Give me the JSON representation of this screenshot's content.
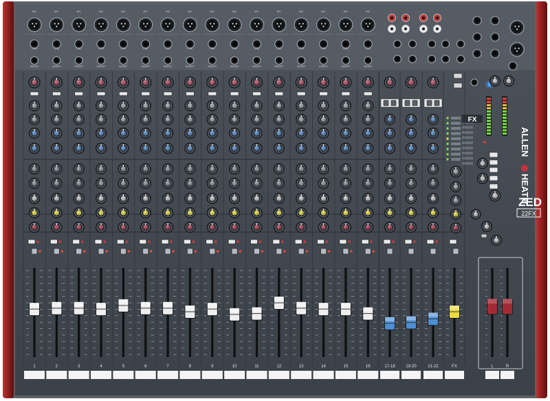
{
  "brand": {
    "name_left": "ALLEN",
    "name_right": "HEATH",
    "model": "ZED",
    "model_sub": "22FX",
    "fx_label": "FX"
  },
  "channels": {
    "mono_numbers": [
      "1",
      "2",
      "3",
      "4",
      "5",
      "6",
      "7",
      "8",
      "9",
      "10",
      "11",
      "12",
      "13",
      "14",
      "15",
      "16"
    ],
    "stereo_numbers": [
      "17-18",
      "19-20",
      "21-22"
    ],
    "fx_strip_number": "FX",
    "master_numbers": [
      "L",
      "R"
    ]
  },
  "jacks": {
    "mic": "MIC",
    "line": "LINE",
    "insert": "INSERT"
  },
  "colors": {
    "panel": "#3e444c",
    "frame": "#5b6169",
    "side_cheek": "#8f1e1e",
    "knob_gain": "#b0475c",
    "knob_eq_blue": "#4d86c6",
    "knob_pan_red": "#a8344a",
    "knob_yellow": "#e8de3a",
    "fader_white": "#eeeeee",
    "fader_blue": "#4c8fd4",
    "fader_yellow": "#ecdc3a",
    "fader_red": "#a22a34",
    "meter_green": "#7adf3c",
    "power_led": "#4aa3ff"
  },
  "faders": {
    "channel_levels": [
      0.53,
      0.54,
      0.54,
      0.53,
      0.57,
      0.54,
      0.54,
      0.5,
      0.53,
      0.47,
      0.48,
      0.6,
      0.54,
      0.53,
      0.53,
      0.48,
      0.37,
      0.38,
      0.42,
      0.5
    ],
    "master_levels": [
      0.56,
      0.56
    ]
  }
}
